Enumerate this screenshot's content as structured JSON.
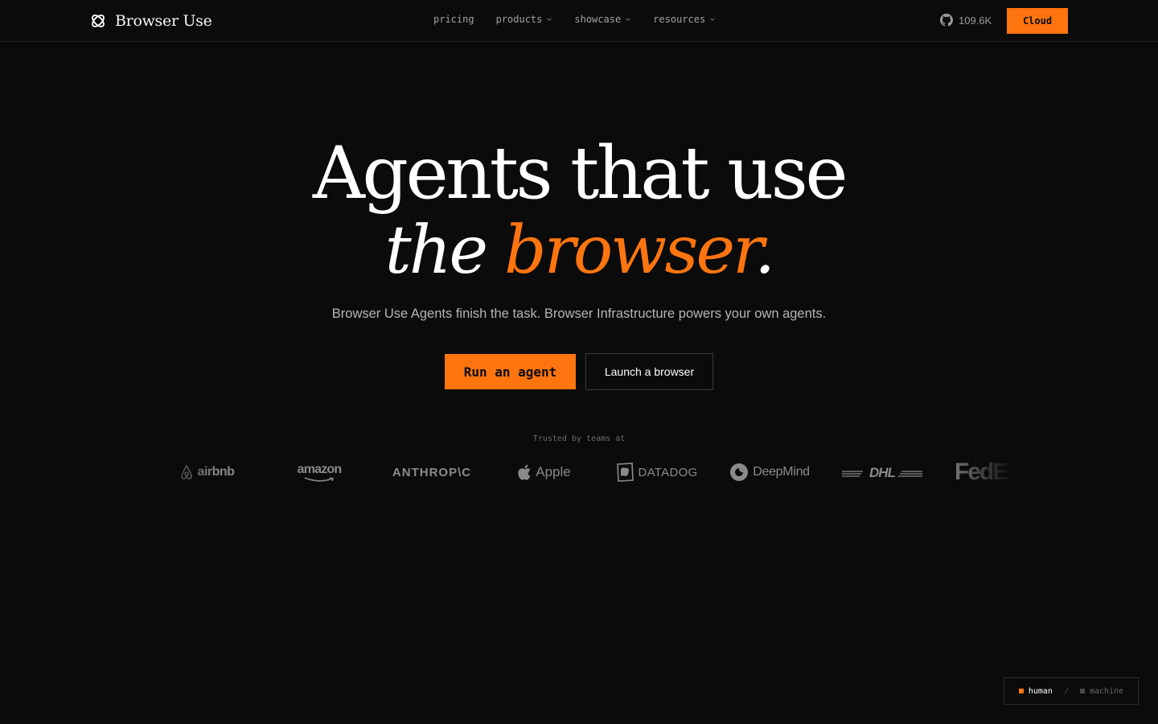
{
  "header": {
    "brand_name": "Browser Use",
    "nav": [
      {
        "label": "pricing",
        "dropdown": false
      },
      {
        "label": "products",
        "dropdown": true
      },
      {
        "label": "showcase",
        "dropdown": true
      },
      {
        "label": "resources",
        "dropdown": true
      }
    ],
    "github_stars": "109.6K",
    "cloud_label": "Cloud"
  },
  "hero": {
    "title_line1": "Agents that use",
    "title_line2_word1": "the",
    "title_line2_word2": "browser",
    "title_line2_punct": ".",
    "subtitle": "Browser Use Agents finish the task. Browser Infrastructure powers your own agents.",
    "primary_cta": "Run an agent",
    "secondary_cta": "Launch a browser"
  },
  "trusted": {
    "label": "Trusted by teams at",
    "logos": [
      "airbnb",
      "amazon",
      "ANTHROP\\C",
      "Apple",
      "DATADOG",
      "DeepMind",
      "DHL",
      "FedEx"
    ]
  },
  "mode_toggle": {
    "active": "human",
    "separator": "/",
    "inactive": "machine"
  },
  "colors": {
    "background": "#0b0b0c",
    "accent": "#fe750f",
    "text": "#ffffff",
    "muted": "#a3a3a3"
  },
  "icons": [
    "browser-use-logo-icon",
    "chevron-down-icon",
    "github-icon",
    "apple-icon",
    "airbnb-icon",
    "datadog-icon",
    "deepmind-icon"
  ]
}
